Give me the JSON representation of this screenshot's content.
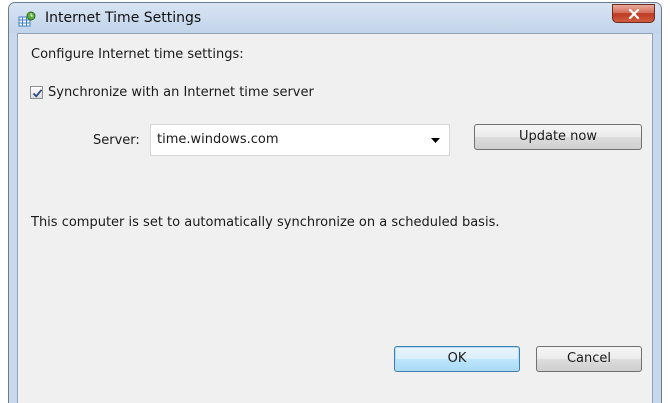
{
  "window": {
    "title": "Internet Time Settings"
  },
  "content": {
    "heading": "Configure Internet time settings:",
    "sync_checkbox": {
      "label": "Synchronize with an Internet time server",
      "checked": true
    },
    "server": {
      "label": "Server:",
      "value": "time.windows.com"
    },
    "update_button_label": "Update now",
    "status_text": "This computer is set to automatically synchronize on a scheduled basis."
  },
  "footer": {
    "ok_label": "OK",
    "cancel_label": "Cancel"
  },
  "icons": {
    "title": "clock-globe-icon",
    "close": "close-icon",
    "dropdown": "chevron-down-icon",
    "check": "checkmark-icon"
  },
  "colors": {
    "titlebar": "#c7d8ed",
    "close_button": "#c9452a",
    "dialog_background": "#f0f0f0",
    "default_button_border": "#3c7fb1"
  }
}
